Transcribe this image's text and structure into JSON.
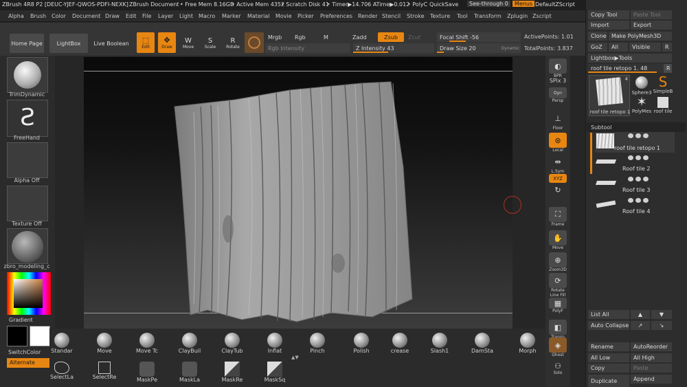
{
  "titlebar": {
    "app": "ZBrush 4R8 P2 [DEUC-YJEF-QWOS-PDFI-NEXK]",
    "doc": "ZBrush Document",
    "free_mem": "• Free Mem 8.16GB",
    "active_mem": "• Active Mem 4352",
    "scratch": "• Scratch Disk 41",
    "timer": "• Timer▶14.706 ATime▶0.012",
    "polyc": "• PolyC",
    "quicksave": "QuickSave",
    "seethrough": "See-through",
    "seethrough_val": "0",
    "menus": "Menus",
    "script": "DefaultZScript"
  },
  "menus": [
    "Alpha",
    "Brush",
    "Color",
    "Document",
    "Draw",
    "Edit",
    "File",
    "Layer",
    "Light",
    "Macro",
    "Marker",
    "Material",
    "Movie",
    "Picker",
    "Preferences",
    "Render",
    "Stencil",
    "Stroke",
    "Texture",
    "Tool",
    "Transform",
    "Zplugin",
    "Zscript"
  ],
  "topshelf": {
    "home": "Home Page",
    "lightbox": "LightBox",
    "liveboolean": "Live Boolean",
    "edit": "Edit",
    "draw": "Draw",
    "move": "Move",
    "scale": "Scale",
    "rotate": "Rotate",
    "mrgb": "Mrgb",
    "rgb": "Rgb",
    "m": "M",
    "zadd": "Zadd",
    "zsub": "Zsub",
    "zcut": "Zcut",
    "rgb_intensity": "Rgb Intensity",
    "z_intensity_label": "Z Intensity",
    "z_intensity": "43",
    "z_intensity_frac": 0.43,
    "focal_label": "Focal Shift",
    "focal": "-56",
    "drawsize_label": "Draw Size",
    "drawsize": "20",
    "dynamic": "Dynamic",
    "activepoints": "ActivePoints: 1.01",
    "totalpoints": "TotalPoints: 3.837"
  },
  "leftpanel": {
    "brush": "TrimDynamic",
    "stroke": "FreeHand",
    "alpha": "Alpha Off",
    "texture": "Texture Off",
    "material": "zbro_modeling_c",
    "gradient": "Gradient",
    "switchcolor": "SwitchColor",
    "alternate": "Alternate"
  },
  "rightshelf": {
    "bpr": "BPR",
    "spix_label": "SPix",
    "spix": "3",
    "persp": "Persp",
    "floor": "Floor",
    "local": "Local",
    "lsym": "L.Sym",
    "xyz": "XYZ",
    "frame": "Frame",
    "move": "Move",
    "zoom3d": "Zoom3D",
    "rotate": "Rotate",
    "linefill": "Line Fill",
    "polyf": "PolyF",
    "transp": "Transp",
    "ghost": "Ghost",
    "solo": "Solo"
  },
  "bottomshelf": {
    "brushes": [
      "Standar",
      "Move",
      "Move Tc",
      "ClayBuil",
      "ClayTub",
      "Inflat",
      "Pinch",
      "Polish",
      "crease",
      "Slash1",
      "DamSta",
      "Morph"
    ],
    "masks": [
      "SelectLa",
      "SelectRe",
      "MaskPe",
      "MaskLa",
      "MaskRe",
      "MaskSq"
    ]
  },
  "rpanel": {
    "copytool": "Copy Tool",
    "pastetool": "Paste Tool",
    "import": "Import",
    "export": "Export",
    "clone": "Clone",
    "makepoly": "Make PolyMesh3D",
    "goz": "GoZ",
    "all": "All",
    "visible": "Visible",
    "r": "R",
    "lightboxtools": "Lightbox▶Tools",
    "toolname": "roof tile retopo 1. 48",
    "thumbs": [
      "roof tile retopo 1",
      "Sphere3",
      "SimpleB",
      "PolyMes",
      "roof tile"
    ],
    "thumb_count": "4",
    "subtool": "Subtool",
    "subtools": [
      "roof tile retopo 1",
      "Roof tile 2",
      "Roof tile 3",
      "Roof tile 4"
    ],
    "listall": "List All",
    "autocollapse": "Auto Collapse",
    "rename": "Rename",
    "autoreorder": "AutoReorder",
    "alllow": "All Low",
    "allhigh": "All High",
    "copy": "Copy",
    "paste": "Paste",
    "duplicate": "Duplicate",
    "append": "Append"
  },
  "colors": {
    "accent": "#e88612",
    "panel": "#2d2d2d",
    "canvas": "#0a0a0a"
  }
}
